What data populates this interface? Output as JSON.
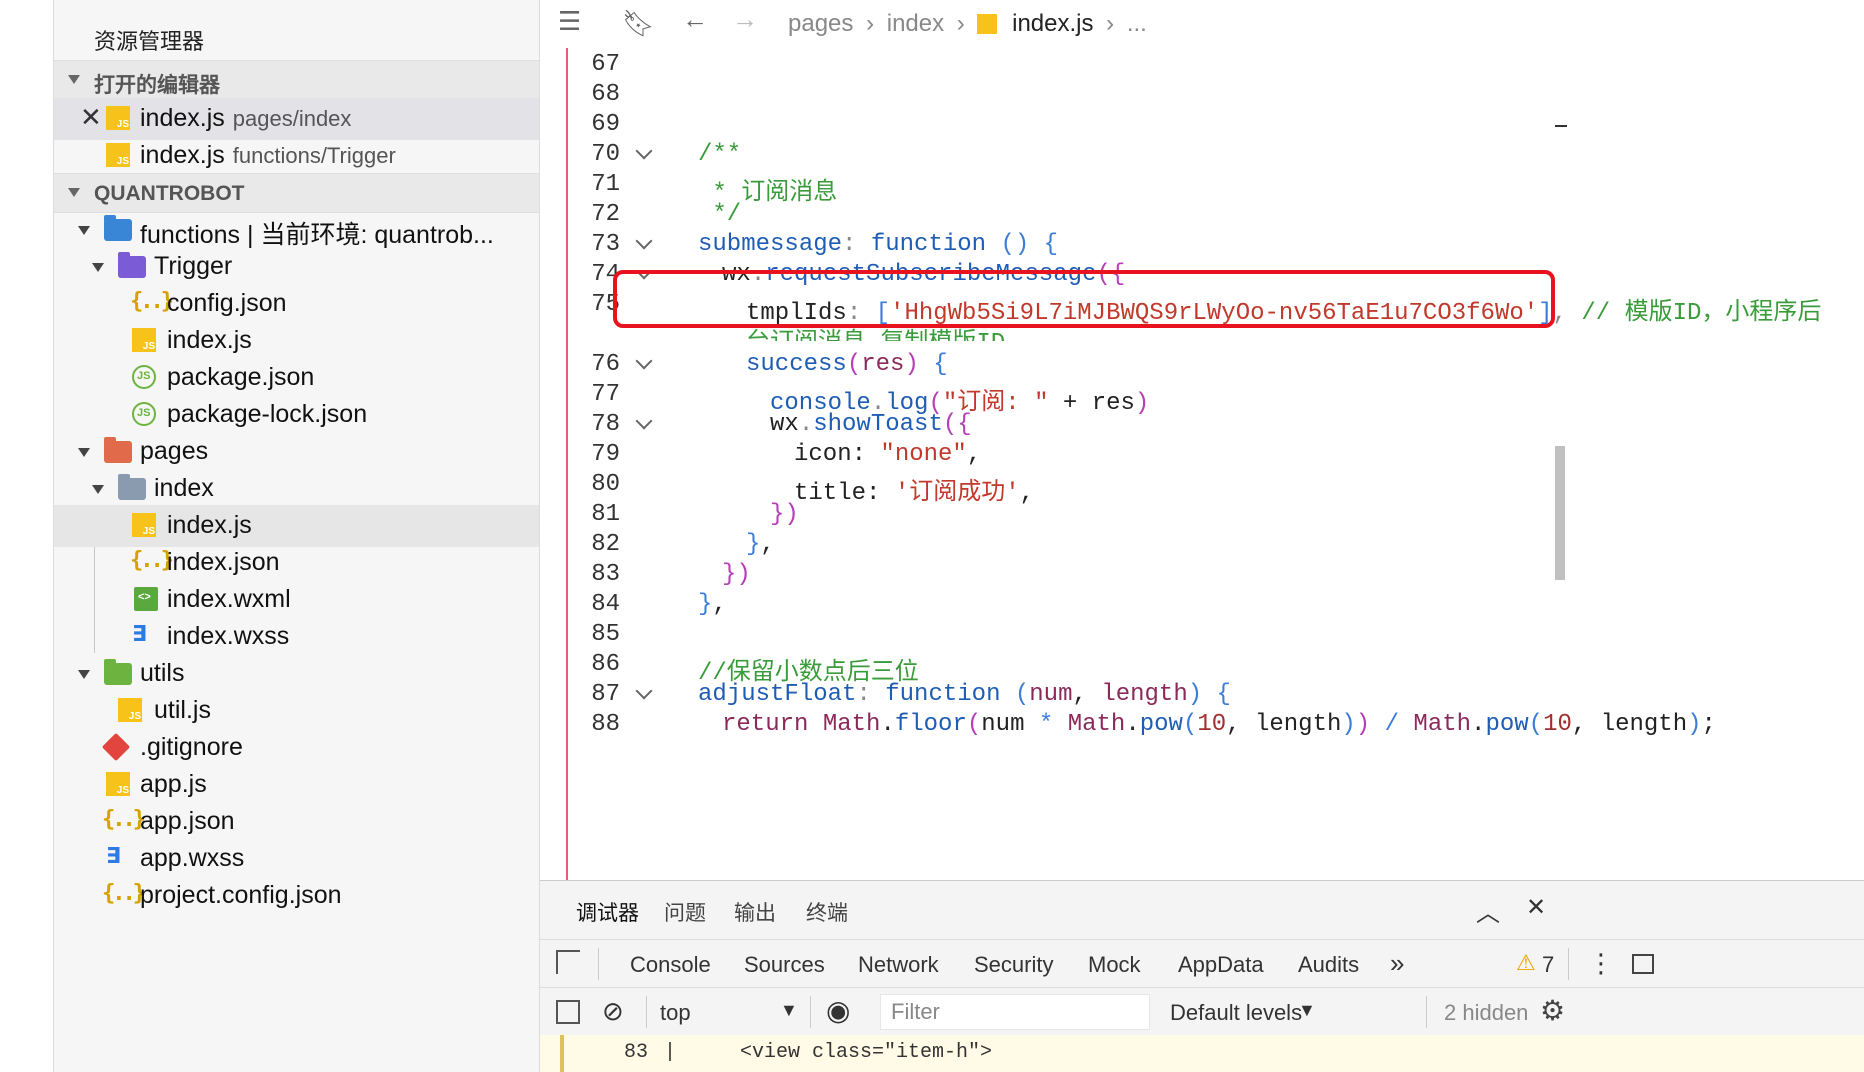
{
  "explorer": {
    "title": "资源管理器",
    "open_editors_label": "打开的编辑器",
    "open_editors": [
      {
        "name": "index.js",
        "path": "pages/index"
      },
      {
        "name": "index.js",
        "path": "functions/Trigger"
      }
    ],
    "project_label": "QUANTROBOT",
    "tree": {
      "functions": "functions | 当前环境: quantrob...",
      "trigger": "Trigger",
      "config_json": "config.json",
      "index_js": "index.js",
      "package_json": "package.json",
      "package_lock": "package-lock.json",
      "pages": "pages",
      "index_folder": "index",
      "pages_index_js": "index.js",
      "pages_index_json": "index.json",
      "pages_index_wxml": "index.wxml",
      "pages_index_wxss": "index.wxss",
      "utils": "utils",
      "util_js": "util.js",
      "gitignore": ".gitignore",
      "app_js": "app.js",
      "app_json": "app.json",
      "app_wxss": "app.wxss",
      "project_config": "project.config.json"
    }
  },
  "breadcrumb": {
    "pages": "pages",
    "index": "index",
    "file": "index.js",
    "more": "..."
  },
  "code": {
    "line_numbers": [
      "67",
      "68",
      "69",
      "70",
      "71",
      "72",
      "73",
      "74",
      "75",
      "",
      "76",
      "77",
      "78",
      "79",
      "80",
      "81",
      "82",
      "83",
      "84",
      "85",
      "86",
      "87",
      "88"
    ],
    "comment_open": "/**",
    "comment_body": " * 订阅消息",
    "comment_close": " */",
    "l73_name": "submessage",
    "l73_kw": "function",
    "l74_obj": "wx",
    "l74_fn": "requestSubscribeMessage",
    "l75_key": "tmplIds",
    "l75_str": "'HhgWb5Si9L7iMJBWQS9rLWyOo-nv56TaE1u7CO3f6Wo'",
    "l75_comment": "// 模版ID，小程序后",
    "l75_comment_wrap": "台订阅消息-复制模版ID",
    "l76_fn": "success",
    "l76_param": "res",
    "l77_obj": "console",
    "l77_fn": "log",
    "l77_str": "\"订阅: \"",
    "l77_rest": "res",
    "l78_obj": "wx",
    "l78_fn": "showToast",
    "l79_key": "icon",
    "l79_str": "\"none\"",
    "l80_key": "title",
    "l80_str": "'订阅成功'",
    "l86_comment": "//保留小数点后三位",
    "l87_name": "adjustFloat",
    "l87_kw": "function",
    "l87_p1": "num",
    "l87_p2": "length",
    "l88_kw": "return",
    "l88_math": "Math",
    "l88_floor": "floor",
    "l88_num": "num",
    "l88_pow": "pow",
    "l88_ten": "10",
    "l88_len": "length"
  },
  "panel": {
    "tabs": [
      "调试器",
      "问题",
      "输出",
      "终端"
    ],
    "devtools_tabs": [
      "Console",
      "Sources",
      "Network",
      "Security",
      "Mock",
      "AppData",
      "Audits"
    ],
    "more": "»",
    "warning_count": "7",
    "context": "top",
    "filter_placeholder": "Filter",
    "levels": "Default levels",
    "hidden": "2 hidden",
    "log_line_no": "83",
    "log_text": "<view class=\"item-h\">"
  },
  "colors": {
    "highlight_box": "#e8131f",
    "accent": "#1a73e8",
    "warning": "#f0a000"
  }
}
